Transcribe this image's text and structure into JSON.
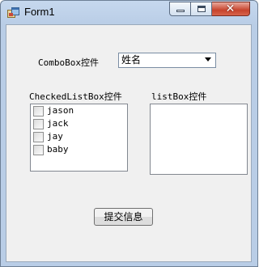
{
  "window": {
    "title": "Form1",
    "controls": {
      "minimize_icon": "minimize-icon",
      "maximize_icon": "maximize-icon",
      "close_icon": "close-icon",
      "close_glyph": "✕"
    },
    "app_icon": "form-app-icon"
  },
  "form": {
    "combobox_label": "ComboBox控件",
    "combobox_value": "姓名",
    "checkedlistbox_label": "CheckedListBox控件",
    "checkedlistbox_items": [
      {
        "label": "jason",
        "checked": false
      },
      {
        "label": "jack",
        "checked": false
      },
      {
        "label": "jay",
        "checked": false
      },
      {
        "label": "baby",
        "checked": false
      }
    ],
    "listbox_label": "listBox控件",
    "listbox_items": [],
    "submit_label": "提交信息"
  },
  "colors": {
    "titlebar": "#c6d8ee",
    "client_bg": "#f0f0f0",
    "close_button": "#c7432c"
  }
}
